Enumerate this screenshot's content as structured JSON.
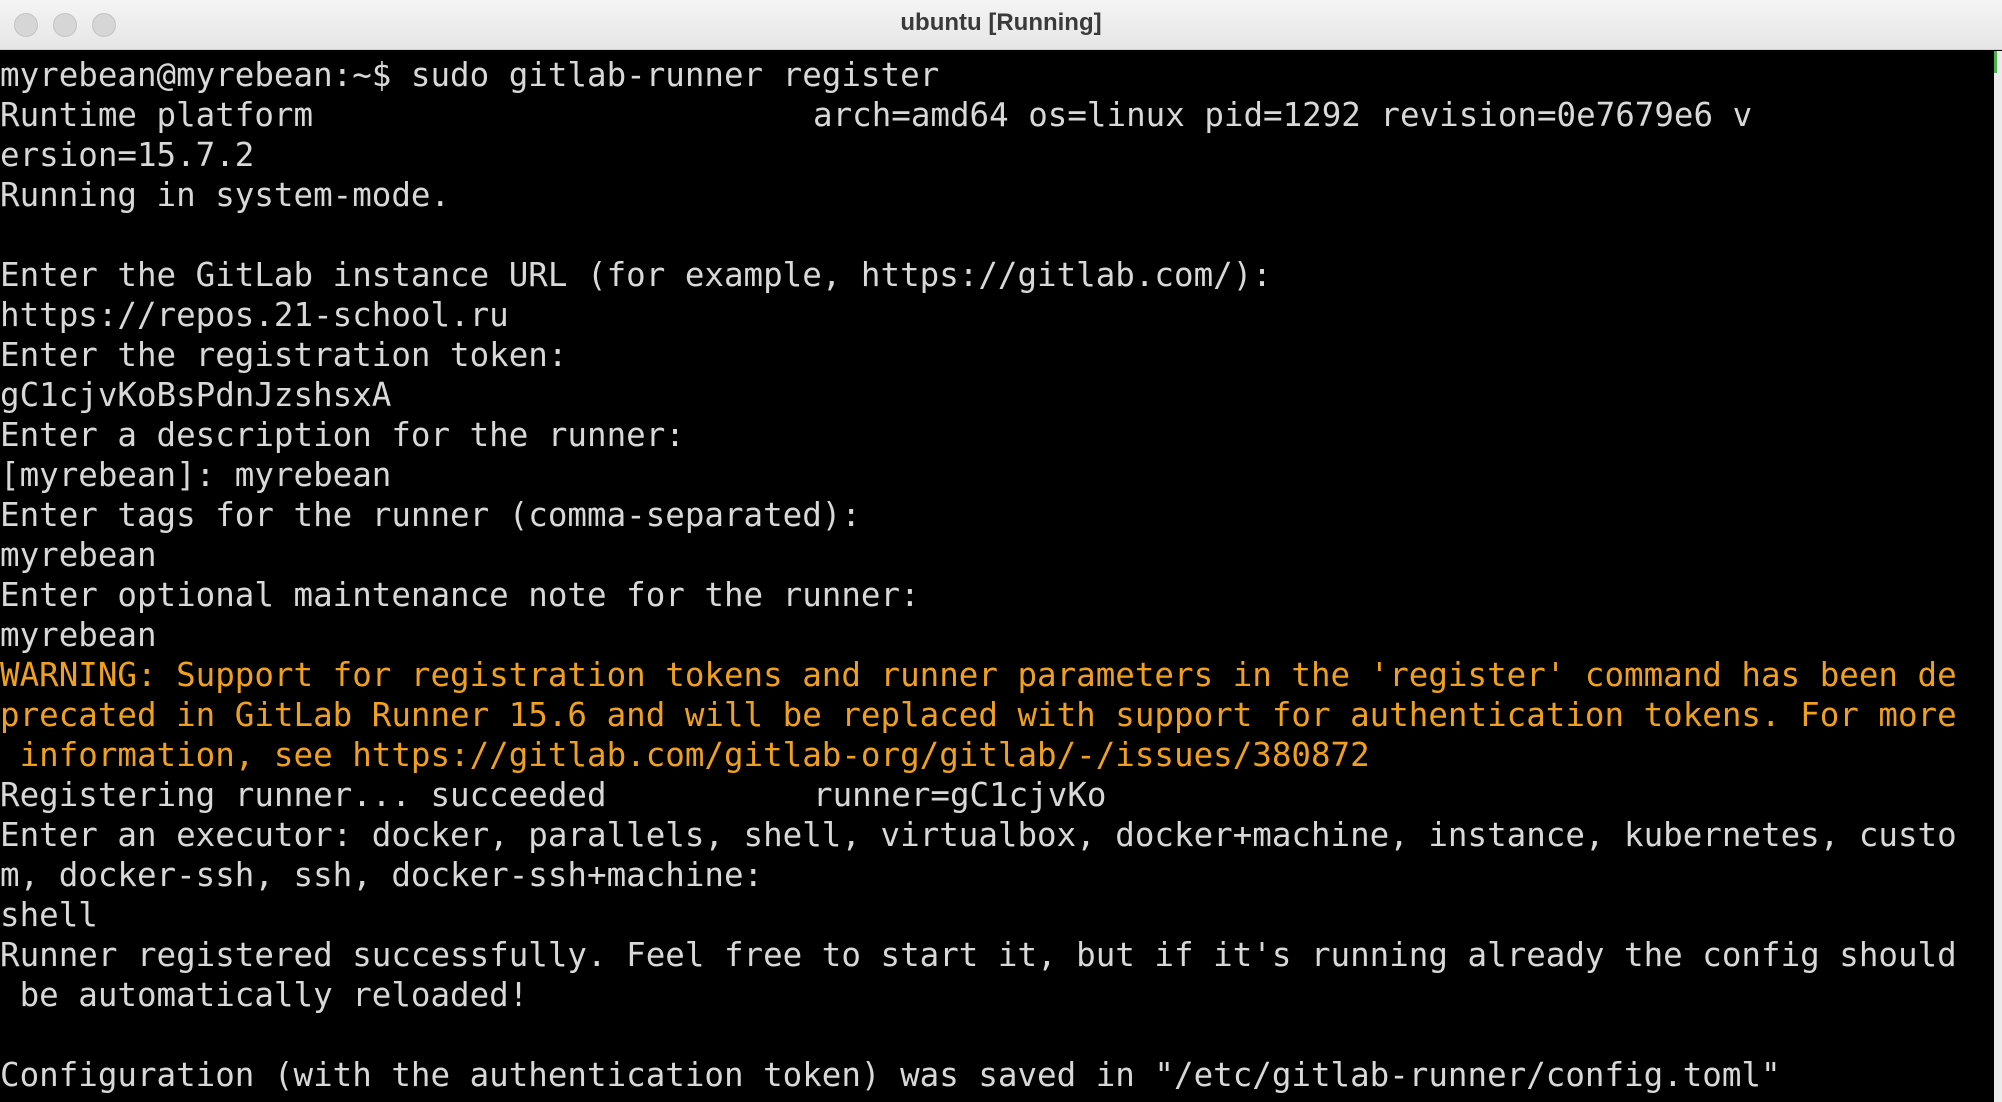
{
  "window": {
    "title": "ubuntu [Running]"
  },
  "colors": {
    "terminal_bg": "#000000",
    "terminal_fg": "#d8d8d8",
    "warning_fg": "#f0a020",
    "titlebar_bg": "#ececec"
  },
  "terminal": {
    "prompt": "myrebean@myrebean:~$ sudo gitlab-runner register",
    "runtime_platform": "Runtime platform",
    "runtime_info": "arch=amd64 os=linux pid=1292 revision=0e7679e6 v",
    "version_cont": "ersion=15.7.2",
    "system_mode": "Running in system-mode.",
    "url_prompt": "Enter the GitLab instance URL (for example, https://gitlab.com/):",
    "url_value": "https://repos.21-school.ru",
    "token_prompt": "Enter the registration token:",
    "token_value": "gC1cjvKoBsPdnJzshsxA",
    "desc_prompt": "Enter a description for the runner:",
    "desc_value": "[myrebean]: myrebean",
    "tags_prompt": "Enter tags for the runner (comma-separated):",
    "tags_value": "myrebean",
    "note_prompt": "Enter optional maintenance note for the runner:",
    "note_value": "myrebean",
    "warning_1": "WARNING: Support for registration tokens and runner parameters in the 'register' command has been de",
    "warning_2": "precated in GitLab Runner 15.6 and will be replaced with support for authentication tokens. For more",
    "warning_3": " information, see https://gitlab.com/gitlab-org/gitlab/-/issues/380872",
    "registering": "Registering runner... succeeded",
    "runner_id": "runner=gC1cjvKo",
    "executor_prompt_1": "Enter an executor: docker, parallels, shell, virtualbox, docker+machine, instance, kubernetes, custo",
    "executor_prompt_2": "m, docker-ssh, ssh, docker-ssh+machine:",
    "executor_value": "shell",
    "success_1": "Runner registered successfully. Feel free to start it, but if it's running already the config should",
    "success_2": " be automatically reloaded!",
    "config_saved": "Configuration (with the authentication token) was saved in \"/etc/gitlab-runner/config.toml\""
  }
}
